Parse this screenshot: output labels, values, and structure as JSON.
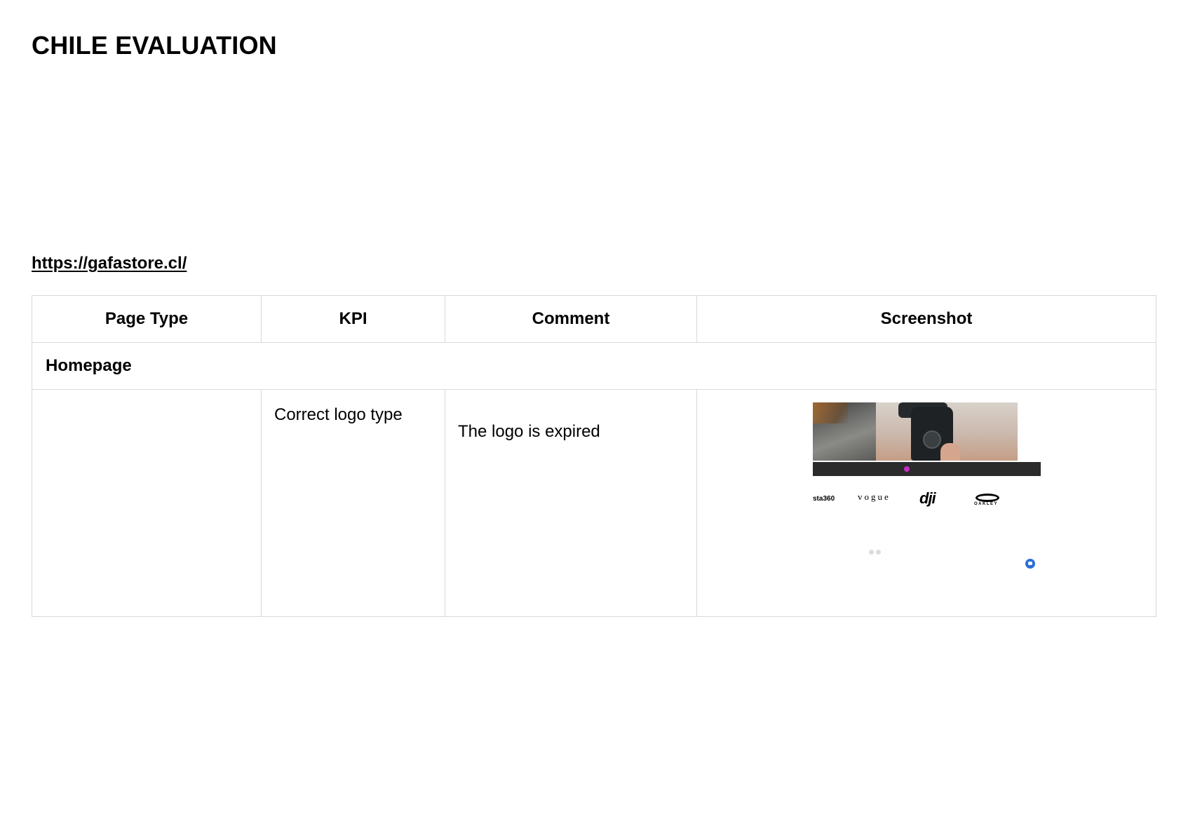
{
  "document": {
    "title": "CHILE EVALUATION",
    "url": "https://gafastore.cl/"
  },
  "table": {
    "headers": [
      "Page Type",
      "KPI",
      "Comment",
      "Screenshot"
    ],
    "section": "Homepage",
    "rows": [
      {
        "page_type": "",
        "kpi": "Correct logo type",
        "comment": "The logo is expired",
        "screenshot": {
          "brands": [
            "sta360",
            "vogue",
            "dji",
            "OAKLEY"
          ]
        }
      }
    ]
  }
}
